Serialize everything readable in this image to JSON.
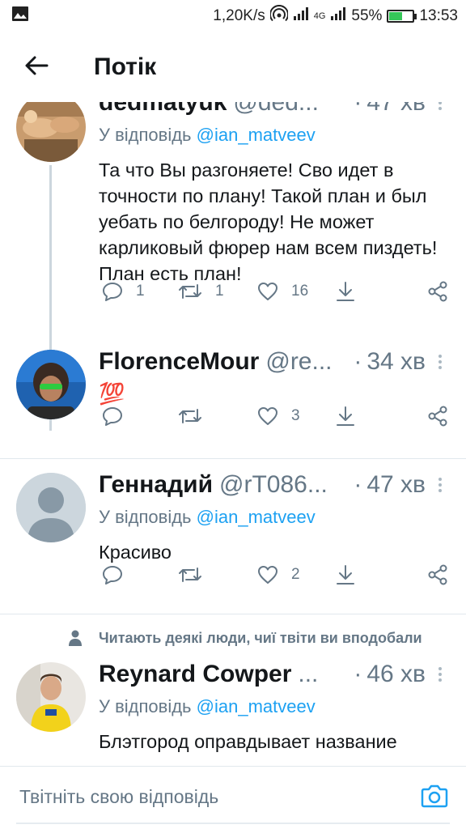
{
  "status_bar": {
    "speed": "1,20K/s",
    "network": "4G",
    "battery": "55%",
    "battery_level": 0.55,
    "time": "13:53"
  },
  "app_bar": {
    "title": "Потік"
  },
  "tweets": [
    {
      "name": "dedmatyuk",
      "handle": "@ded...",
      "time": "47 хв",
      "reply_prefix": "У відповідь",
      "reply_mention": "@ian_matveev",
      "text": "Та что Вы разгоняете! Сво идет в точности по плану! Такой план и был уебать по белгороду! Не может карликовый фюрер нам всем пиздеть! План есть план!",
      "replies": "1",
      "retweets": "1",
      "likes": "16"
    },
    {
      "name": "FlorenceMour",
      "handle": "@re...",
      "time": "34 хв",
      "text": "💯",
      "replies": "",
      "retweets": "",
      "likes": "3"
    },
    {
      "name": "Геннадий",
      "handle": "@rT086...",
      "time": "47 хв",
      "reply_prefix": "У відповідь",
      "reply_mention": "@ian_matveev",
      "text": "Красиво",
      "replies": "",
      "retweets": "",
      "likes": "2"
    },
    {
      "social_context": "Читають деякі люди, чиї твіти ви вподобали",
      "name": "Reynard Cowper",
      "handle": "...",
      "time": "46 хв",
      "reply_prefix": "У відповідь",
      "reply_mention": "@ian_matveev",
      "text": "Блэтгород оправдывает название"
    }
  ],
  "composer": {
    "placeholder": "Твітніть свою відповідь"
  },
  "colors": {
    "accent": "#1da1f2",
    "secondary_text": "#657786",
    "primary_text": "#14171a",
    "divider": "#e1e8ed"
  }
}
